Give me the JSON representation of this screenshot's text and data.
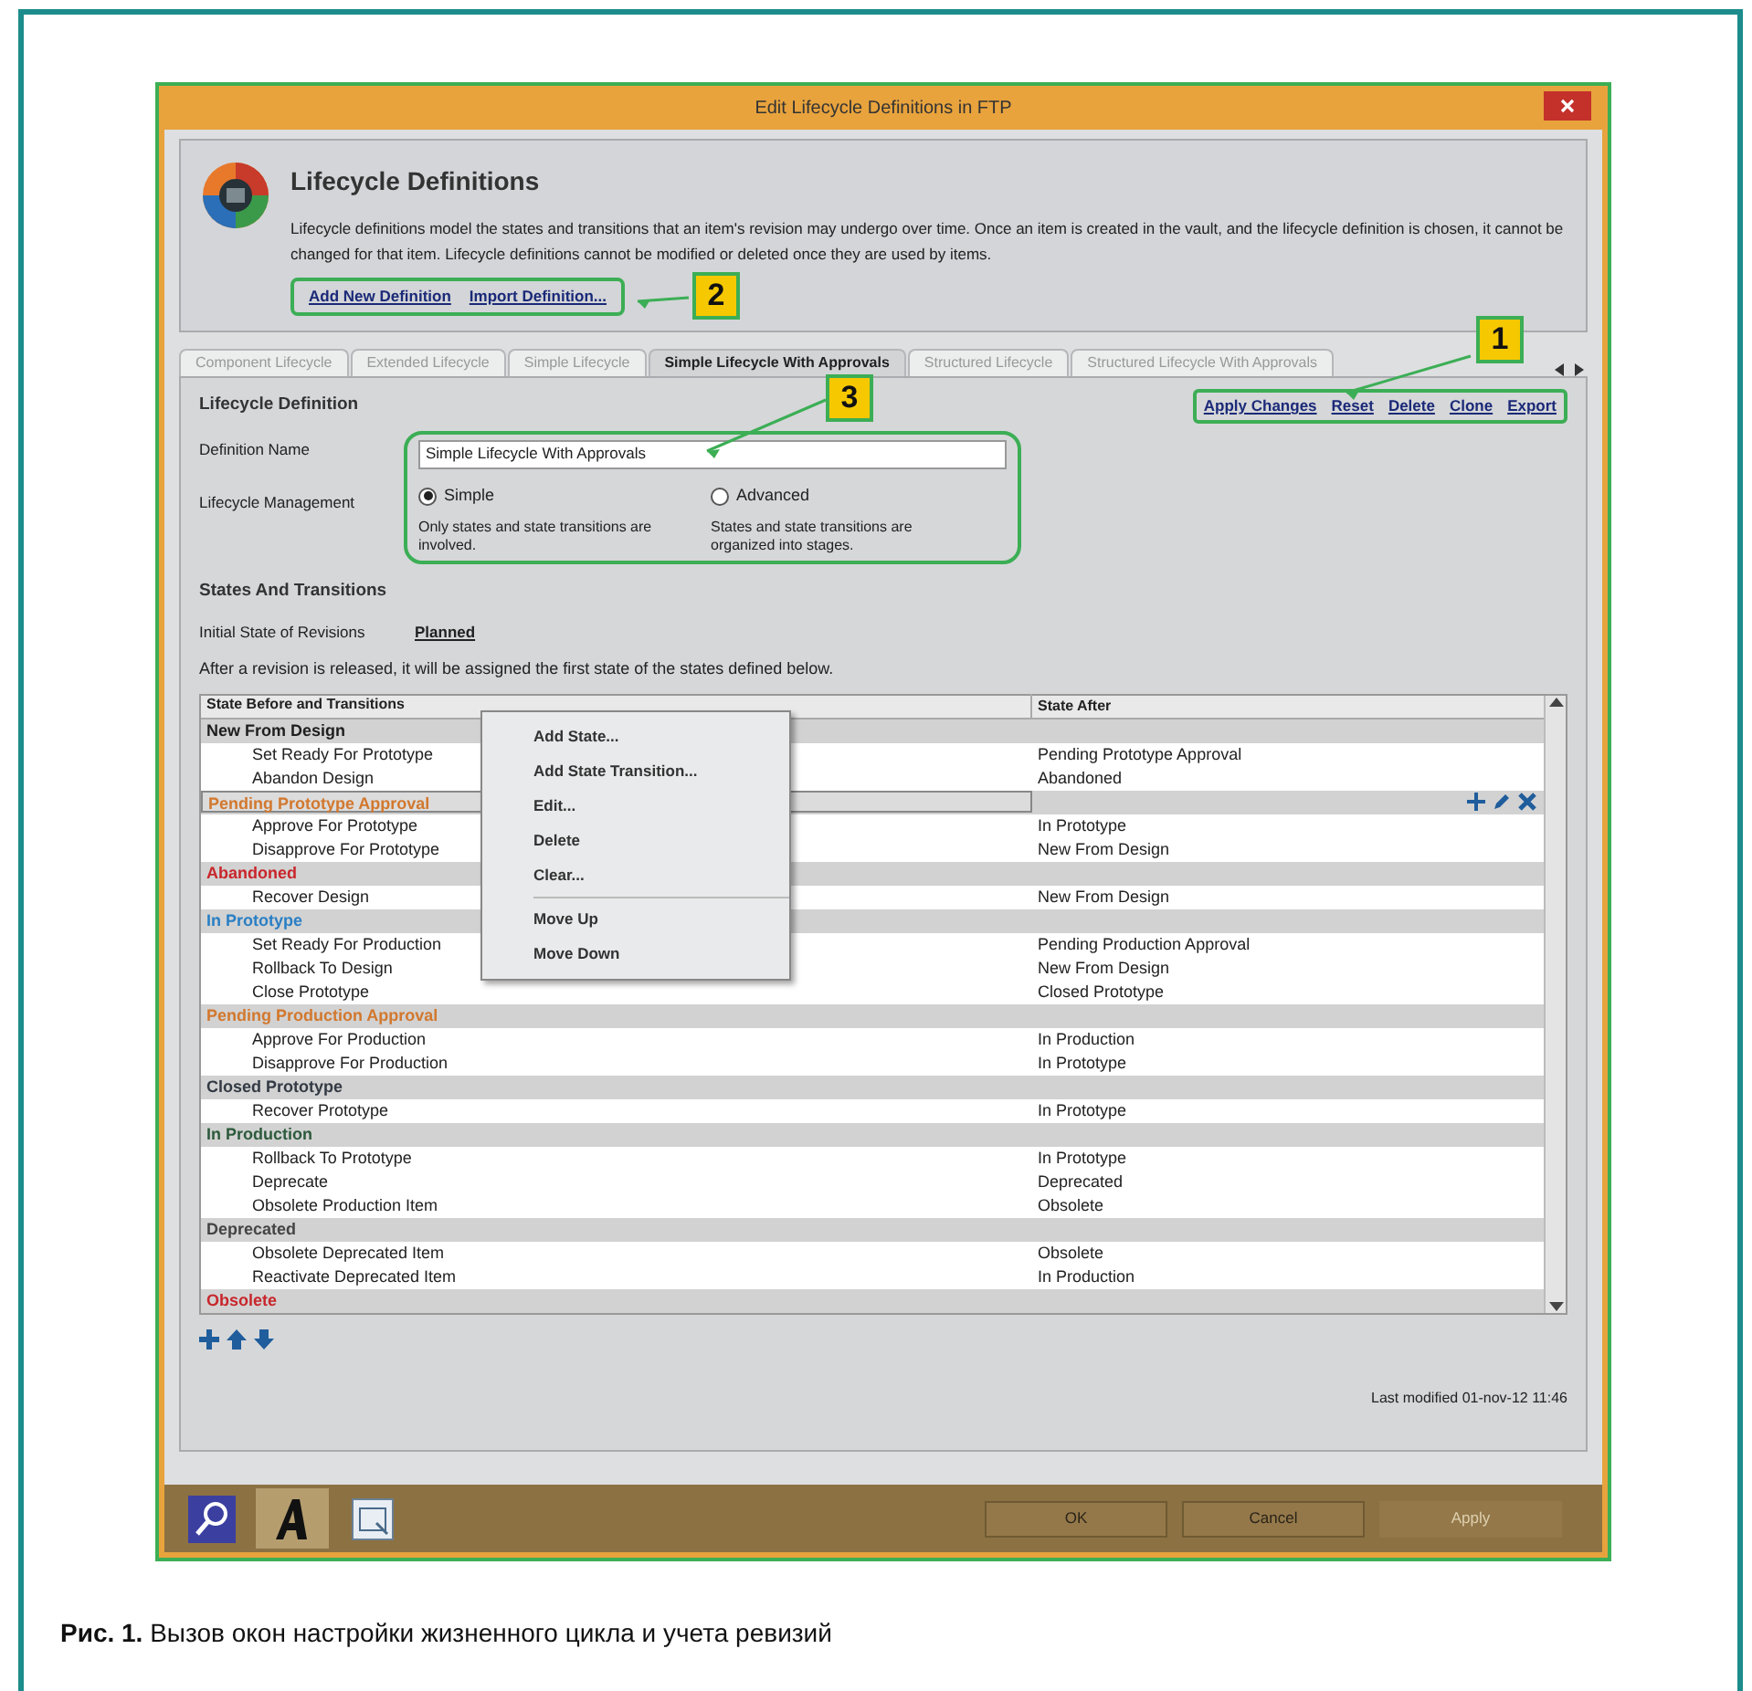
{
  "window": {
    "title": "Edit Lifecycle Definitions in FTP"
  },
  "header": {
    "title": "Lifecycle Definitions",
    "description": "Lifecycle definitions model the states and transitions that an item's revision may undergo over time. Once an item is created in the vault, and the lifecycle definition is chosen, it cannot be changed for that item. Lifecycle definitions cannot be modified or deleted once they are used by items.",
    "links": [
      "Add New Definition",
      "Import Definition..."
    ]
  },
  "tabs": [
    {
      "label": "Component Lifecycle",
      "selected": false
    },
    {
      "label": "Extended Lifecycle",
      "selected": false
    },
    {
      "label": "Simple Lifecycle",
      "selected": false
    },
    {
      "label": "Simple Lifecycle With Approvals",
      "selected": true
    },
    {
      "label": "Structured Lifecycle",
      "selected": false
    },
    {
      "label": "Structured Lifecycle With Approvals",
      "selected": false
    }
  ],
  "actions": [
    "Apply Changes",
    "Reset",
    "Delete",
    "Clone",
    "Export"
  ],
  "section_title": "Lifecycle Definition",
  "definition_name": {
    "label": "Definition Name",
    "value": "Simple Lifecycle With Approvals"
  },
  "lifecycle_management": {
    "label": "Lifecycle Management",
    "options": [
      {
        "label": "Simple",
        "description": "Only states and state transitions are involved.",
        "selected": true
      },
      {
        "label": "Advanced",
        "description": "States and state transitions are organized into stages.",
        "selected": false
      }
    ]
  },
  "states_title": "States And Transitions",
  "initial_state": {
    "label": "Initial State of Revisions",
    "value": "Planned"
  },
  "note": "After a revision is released, it will be assigned the first state of the states defined below.",
  "table": {
    "columns": [
      "State Before and Transitions",
      "State After"
    ],
    "rows": [
      {
        "kind": "state",
        "name": "New From Design",
        "color": "#1e1e1e",
        "selected": false
      },
      {
        "kind": "transition",
        "name": "Set Ready For Prototype",
        "after": "Pending Prototype Approval"
      },
      {
        "kind": "transition",
        "name": "Abandon Design",
        "after": "Abandoned"
      },
      {
        "kind": "state",
        "name": "Pending Prototype Approval",
        "color": "#d2782e",
        "selected": true
      },
      {
        "kind": "transition",
        "name": "Approve For Prototype",
        "after": "In Prototype"
      },
      {
        "kind": "transition",
        "name": "Disapprove For Prototype",
        "after": "New From Design"
      },
      {
        "kind": "state",
        "name": "Abandoned",
        "color": "#c8262b",
        "selected": false
      },
      {
        "kind": "transition",
        "name": "Recover Design",
        "after": "New From Design"
      },
      {
        "kind": "state",
        "name": "In Prototype",
        "color": "#2a7fc4",
        "selected": false
      },
      {
        "kind": "transition",
        "name": "Set Ready For Production",
        "after": "Pending Production Approval"
      },
      {
        "kind": "transition",
        "name": "Rollback To Design",
        "after": "New From Design"
      },
      {
        "kind": "transition",
        "name": "Close Prototype",
        "after": "Closed Prototype"
      },
      {
        "kind": "state",
        "name": "Pending Production Approval",
        "color": "#d2782e",
        "selected": false
      },
      {
        "kind": "transition",
        "name": "Approve For Production",
        "after": "In Production"
      },
      {
        "kind": "transition",
        "name": "Disapprove For Production",
        "after": "In Prototype"
      },
      {
        "kind": "state",
        "name": "Closed Prototype",
        "color": "#333a44",
        "selected": false
      },
      {
        "kind": "transition",
        "name": "Recover Prototype",
        "after": "In Prototype"
      },
      {
        "kind": "state",
        "name": "In Production",
        "color": "#2c5a3c",
        "selected": false
      },
      {
        "kind": "transition",
        "name": "Rollback To Prototype",
        "after": "In Prototype"
      },
      {
        "kind": "transition",
        "name": "Deprecate",
        "after": "Deprecated"
      },
      {
        "kind": "transition",
        "name": "Obsolete Production Item",
        "after": "Obsolete"
      },
      {
        "kind": "state",
        "name": "Deprecated",
        "color": "#444444",
        "selected": false
      },
      {
        "kind": "transition",
        "name": "Obsolete Deprecated Item",
        "after": "Obsolete"
      },
      {
        "kind": "transition",
        "name": "Reactivate Deprecated Item",
        "after": "In Production"
      },
      {
        "kind": "state",
        "name": "Obsolete",
        "color": "#c8262b",
        "selected": false
      }
    ]
  },
  "context_menu": [
    {
      "kind": "item",
      "label": "Add State..."
    },
    {
      "kind": "item",
      "label": "Add State Transition..."
    },
    {
      "kind": "item",
      "label": "Edit..."
    },
    {
      "kind": "item",
      "label": "Delete"
    },
    {
      "kind": "item",
      "label": "Clear..."
    },
    {
      "kind": "separator"
    },
    {
      "kind": "item",
      "label": "Move Up"
    },
    {
      "kind": "item",
      "label": "Move Down"
    }
  ],
  "last_modified": "Last modified 01-nov-12 11:46",
  "buttons": [
    {
      "label": "OK",
      "disabled": false
    },
    {
      "label": "Cancel",
      "disabled": false
    },
    {
      "label": "Apply",
      "disabled": true
    }
  ],
  "callouts": [
    "1",
    "2",
    "3"
  ],
  "caption": "**Рис. 1.** Вызов окон настройки жизненного цикла и учета ревизий"
}
